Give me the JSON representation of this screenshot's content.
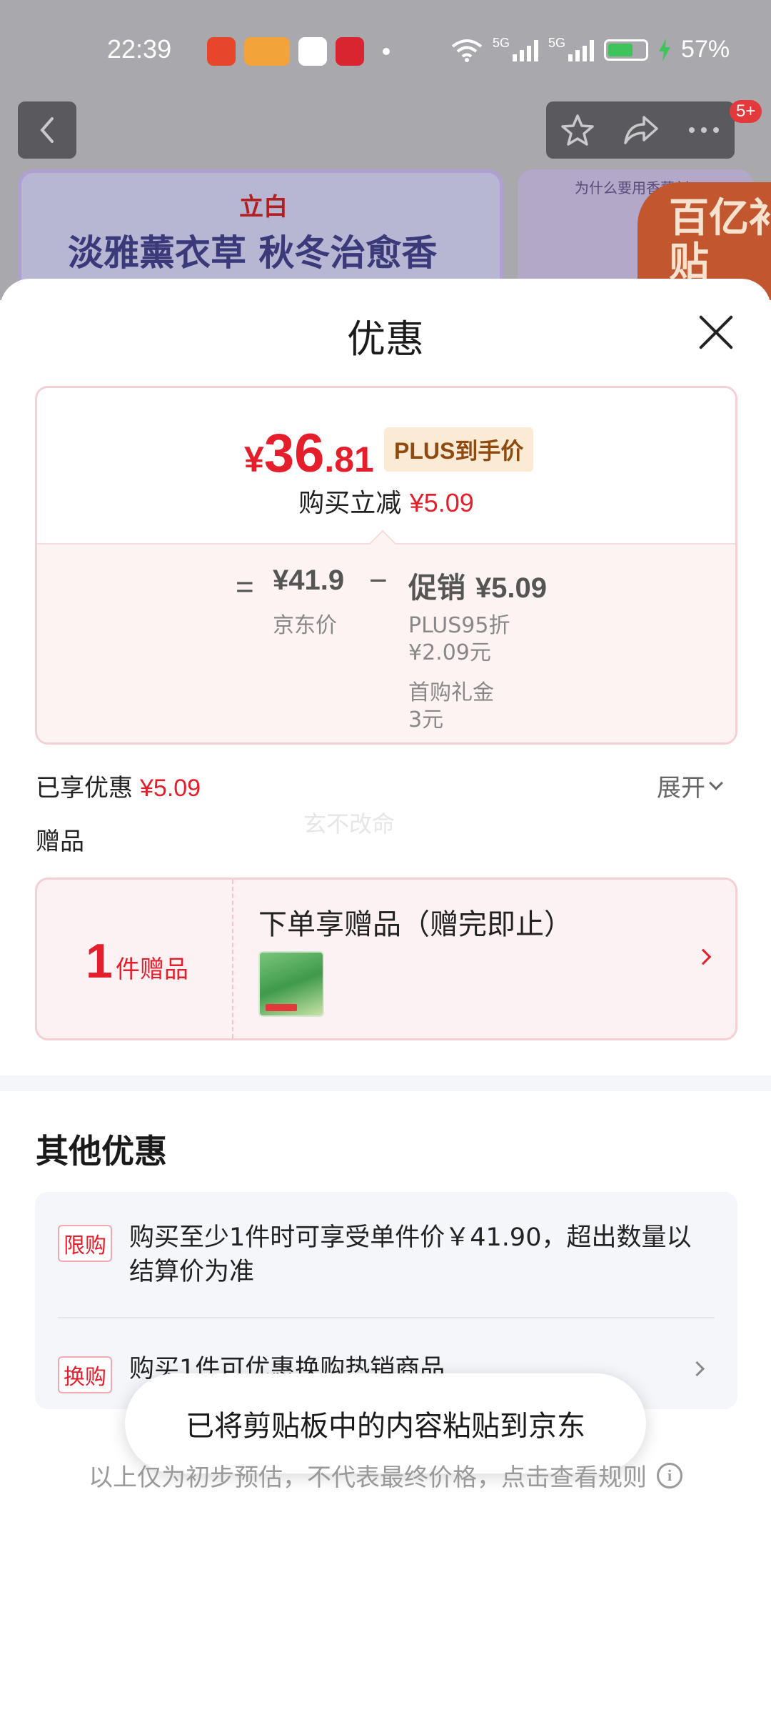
{
  "status_bar": {
    "time": "22:39",
    "battery_percent": "57%",
    "network_1": "5G",
    "network_2": "5G"
  },
  "background": {
    "notification_badge": "5+",
    "banner_brand": "立白",
    "banner_title": "淡雅薰衣草 秋冬治愈香",
    "banner_right_caption": "为什么要用香薰剂",
    "subsidy_text": "百亿补贴"
  },
  "sheet": {
    "title": "优惠",
    "price_card": {
      "currency": "¥",
      "price_int": "36",
      "price_dec": ".81",
      "plus_tag": "PLUS到手价",
      "instant_discount_label": "购买立减",
      "instant_discount_value": "¥5.09",
      "equals": "=",
      "jd_price_value": "¥41.9",
      "jd_price_label": "京东价",
      "minus": "−",
      "promo_label": "促销",
      "promo_value": "¥5.09",
      "promo_detail_1": "PLUS95折",
      "promo_detail_1_value": "¥2.09元",
      "promo_detail_2": "首购礼金",
      "promo_detail_2_value": "3元"
    },
    "enjoyed_label": "已享优惠",
    "enjoyed_value": "¥5.09",
    "expand_label": "展开",
    "watermark": "玄不改命",
    "gift_section_label": "赠品",
    "gift_card": {
      "count": "1",
      "count_label": "件赠品",
      "headline": "下单享赠品（赠完即止）"
    },
    "other_title": "其他优惠",
    "other_items": [
      {
        "tag": "限购",
        "text": "购买至少1件时可享受单件价￥41.90，超出数量以结算价为准"
      },
      {
        "tag": "换购",
        "text": "购买1件可优惠换购热销商品"
      }
    ],
    "toast": "已将剪贴板中的内容粘贴到京东",
    "footnote": "以上仅为初步预估，不代表最终价格，点击查看规则"
  },
  "colors": {
    "accent_red": "#e41f2b",
    "plus_gold": "#8e4a10",
    "card_border": "#f6cfd4"
  },
  "icons": [
    "back-arrow-icon",
    "star-icon",
    "share-icon",
    "more-icon",
    "close-icon",
    "chevron-down-icon",
    "chevron-right-icon",
    "info-icon"
  ]
}
